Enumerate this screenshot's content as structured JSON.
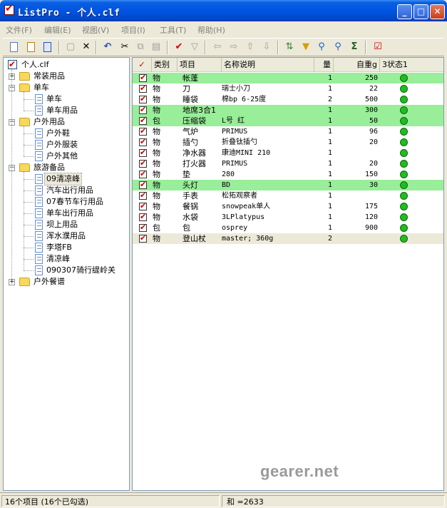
{
  "window": {
    "title": "ListPro - 个人.clf",
    "minimize": "_",
    "maximize": "□",
    "close": "✕"
  },
  "menu": [
    "文件(F)",
    "编辑(E)",
    "视图(V)",
    "项目(I)",
    "工具(T)",
    "帮助(H)"
  ],
  "toolbar_icons": [
    "new-icon",
    "open-icon",
    "save-icon",
    "copy-doc-icon",
    "delete-icon",
    "undo-icon",
    "cut-icon",
    "copy-icon",
    "paste-icon",
    "check-icon",
    "filter-icon",
    "arrow-left-icon",
    "arrow-right-icon",
    "arrow-up-icon",
    "arrow-down-icon",
    "sort-icon",
    "highlight-icon",
    "search-icon",
    "find-next-icon",
    "sum-icon",
    "checklist-icon"
  ],
  "tree": {
    "root": "个人.clf",
    "nodes": [
      {
        "label": "常装用品",
        "level": 1,
        "type": "folder",
        "expander": "+"
      },
      {
        "label": "单车",
        "level": 1,
        "type": "folder",
        "expander": "-"
      },
      {
        "label": "单车",
        "level": 2,
        "type": "file"
      },
      {
        "label": "单车用品",
        "level": 2,
        "type": "file"
      },
      {
        "label": "户外用品",
        "level": 1,
        "type": "folder",
        "expander": "-"
      },
      {
        "label": "户外鞋",
        "level": 2,
        "type": "file"
      },
      {
        "label": "户外服装",
        "level": 2,
        "type": "file"
      },
      {
        "label": "户外其他",
        "level": 2,
        "type": "file"
      },
      {
        "label": "旅游备品",
        "level": 1,
        "type": "folder",
        "expander": "-"
      },
      {
        "label": "09清凉峰",
        "level": 2,
        "type": "file",
        "selected": true
      },
      {
        "label": "汽车出行用品",
        "level": 2,
        "type": "file"
      },
      {
        "label": "07春节车行用品",
        "level": 2,
        "type": "file"
      },
      {
        "label": "单车出行用品",
        "level": 2,
        "type": "file"
      },
      {
        "label": "坝上用品",
        "level": 2,
        "type": "file"
      },
      {
        "label": "浑水濮用品",
        "level": 2,
        "type": "file"
      },
      {
        "label": "李塔FB",
        "level": 2,
        "type": "file"
      },
      {
        "label": "清凉峰",
        "level": 2,
        "type": "file"
      },
      {
        "label": "090307骑行缇岭关",
        "level": 2,
        "type": "file"
      },
      {
        "label": "户外餐谱",
        "level": 1,
        "type": "folder",
        "expander": "+"
      }
    ]
  },
  "list": {
    "columns": [
      "✓",
      "类别",
      "项目",
      "名称说明",
      "量",
      "自重g",
      "3状态1"
    ],
    "rows": [
      {
        "cat": "物",
        "item": "帐蓬",
        "desc": "",
        "qty": "1",
        "weight": "250",
        "hl": true
      },
      {
        "cat": "物",
        "item": "刀",
        "desc": "瑞士小刀",
        "qty": "1",
        "weight": "22",
        "hl": false
      },
      {
        "cat": "物",
        "item": "睡袋",
        "desc": "棉bp 6-25度",
        "qty": "2",
        "weight": "500",
        "hl": false
      },
      {
        "cat": "物",
        "item": "地席3合1",
        "desc": "",
        "qty": "1",
        "weight": "300",
        "hl": true
      },
      {
        "cat": "包",
        "item": "压缩袋",
        "desc": "L号 红",
        "qty": "1",
        "weight": "50",
        "hl": true
      },
      {
        "cat": "物",
        "item": "气炉",
        "desc": "PRIMUS",
        "qty": "1",
        "weight": "96",
        "hl": false
      },
      {
        "cat": "物",
        "item": "插勺",
        "desc": "折叠钛插勺",
        "qty": "1",
        "weight": "20",
        "hl": false
      },
      {
        "cat": "物",
        "item": "净水器",
        "desc": "康迪MINI 210",
        "qty": "1",
        "weight": "",
        "hl": false
      },
      {
        "cat": "物",
        "item": "打火器",
        "desc": "PRIMUS",
        "qty": "1",
        "weight": "20",
        "hl": false
      },
      {
        "cat": "物",
        "item": "垫",
        "desc": "280",
        "qty": "1",
        "weight": "150",
        "hl": false
      },
      {
        "cat": "物",
        "item": "头灯",
        "desc": "BD",
        "qty": "1",
        "weight": "30",
        "hl": true
      },
      {
        "cat": "物",
        "item": "手表",
        "desc": "松拓观察者",
        "qty": "1",
        "weight": "",
        "hl": false
      },
      {
        "cat": "物",
        "item": "餐锅",
        "desc": "snowpeak单人",
        "qty": "1",
        "weight": "175",
        "hl": false
      },
      {
        "cat": "物",
        "item": "水袋",
        "desc": "3LPlatypus",
        "qty": "1",
        "weight": "120",
        "hl": false
      },
      {
        "cat": "包",
        "item": "包",
        "desc": "osprey",
        "qty": "1",
        "weight": "900",
        "hl": false
      },
      {
        "cat": "物",
        "item": "登山杖",
        "desc": "master; 360g",
        "qty": "2",
        "weight": "",
        "hl": false
      }
    ]
  },
  "watermark": "gearer.net",
  "status": {
    "left": "16个项目 (16个已勾选)",
    "right": "和 =2633"
  },
  "colors": {
    "highlight_row": "#99ee99",
    "status_dot": "#22bb22",
    "check": "#cc0000",
    "titlebar": "#0054e3"
  }
}
